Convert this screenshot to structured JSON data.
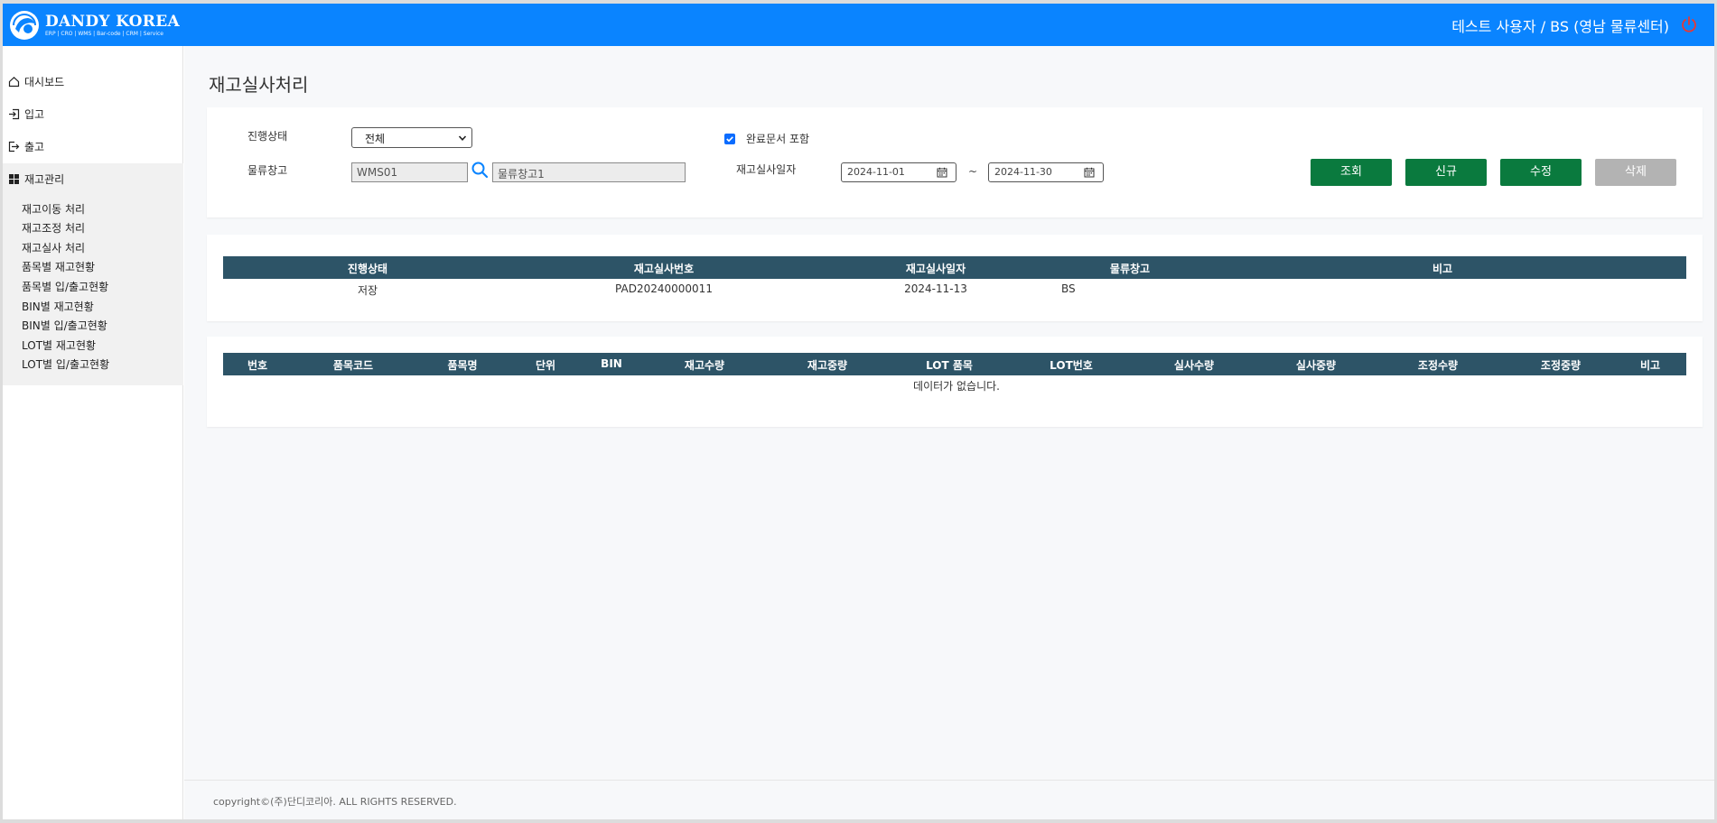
{
  "header": {
    "brand": "DANDY KOREA",
    "brand_tagline": "ERP | CRO | WMS | Bar-code | CRM | Service",
    "user": "테스트 사용자 / BS (영남 물류센터)"
  },
  "sidebar": {
    "items": [
      {
        "label": "대시보드",
        "icon": "home-icon"
      },
      {
        "label": "입고",
        "icon": "sign-in-icon"
      },
      {
        "label": "출고",
        "icon": "sign-out-icon"
      },
      {
        "label": "재고관리",
        "icon": "grid-icon"
      }
    ],
    "sub_items": [
      "재고이동 처리",
      "재고조정 처리",
      "재고실사 처리",
      "품목별 재고현황",
      "품목별 입/출고현황",
      "BIN별 재고현황",
      "BIN별 입/출고현황",
      "LOT별 재고현황",
      "LOT별 입/출고현황"
    ]
  },
  "page": {
    "title": "재고실사처리"
  },
  "search": {
    "status_label": "진행상태",
    "status_value": "전체",
    "warehouse_label": "물류창고",
    "warehouse_code": "WMS01",
    "warehouse_name": "물류창고1",
    "include_completed_label": "완료문서 포함",
    "include_completed_checked": true,
    "date_label": "재고실사일자",
    "date_from": "2024-11-01",
    "date_to": "2024-11-30",
    "tilde": "~"
  },
  "buttons": {
    "search": "조회",
    "new": "신규",
    "edit": "수정",
    "delete": "삭제"
  },
  "master_table": {
    "headers": [
      "진행상태",
      "재고실사번호",
      "재고실사일자",
      "물류창고",
      "비고"
    ],
    "rows": [
      {
        "status": "저장",
        "number": "PAD20240000011",
        "date": "2024-11-13",
        "warehouse": "BS",
        "note": ""
      }
    ]
  },
  "detail_table": {
    "headers": [
      "번호",
      "품목코드",
      "품목명",
      "단위",
      "BIN",
      "재고수량",
      "재고중량",
      "LOT 품목",
      "LOT번호",
      "실사수량",
      "실사중량",
      "조정수량",
      "조정중량",
      "비고"
    ],
    "empty_message": "데이터가 없습니다."
  },
  "footer": {
    "copyright": "copyright©(주)단디코리아. ALL RIGHTS RESERVED."
  },
  "colors": {
    "header_bg": "#0a84ff",
    "table_header_bg": "#2d5467",
    "primary_button": "#0a7a3e",
    "disabled_button": "#b3b3b3"
  }
}
